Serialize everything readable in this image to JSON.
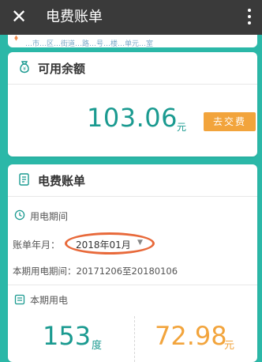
{
  "topbar": {
    "close_icon": "close-icon",
    "title": "电费账单",
    "more_icon": "more-vertical-icon"
  },
  "address_strip": {
    "icon": "location-pin-icon",
    "text": "…市…区…街道…路…号…楼…单元…室"
  },
  "balance_card": {
    "header": "可用余额",
    "icon": "money-bag-icon",
    "amount": "103.06",
    "unit": "元",
    "pay_button": "去交费"
  },
  "bill_card": {
    "header": "电费账单",
    "icon": "bill-document-icon",
    "period_section_label": "用电期间",
    "year_month_label": "账单年月：",
    "year_month_value": "2018年01月",
    "usage_period_text": "本期用电期间：20171206至20180106",
    "usage_section_label": "本期用电",
    "usage_value": "153",
    "usage_unit": "度",
    "fee_value": "72.98",
    "fee_unit": "元"
  },
  "colors": {
    "accent_teal": "#1a9a90",
    "accent_orange": "#f2a43c",
    "highlight_oval": "#e8693a",
    "topbar": "#3a3a3a",
    "background": "#2bb8a8"
  }
}
